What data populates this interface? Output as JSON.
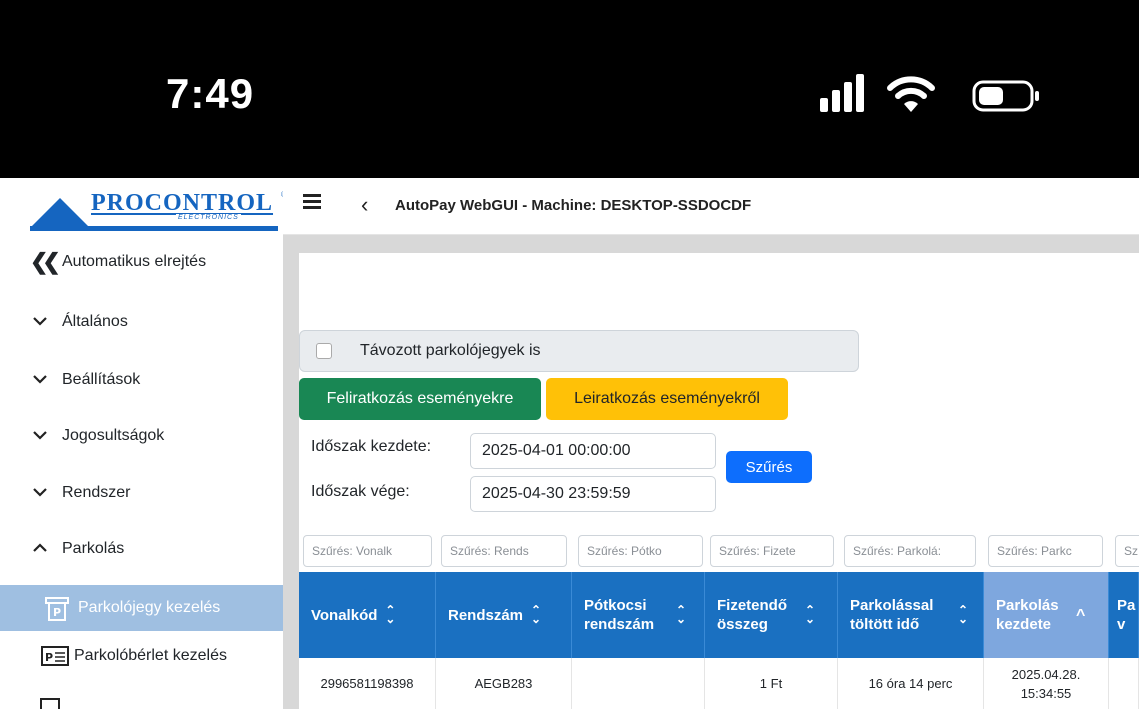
{
  "status_bar": {
    "time": "7:49"
  },
  "sidebar": {
    "logo_text": "PROCONTROL",
    "logo_sub": "ELECTRONICS",
    "collapse_label": "Automatikus elrejtés",
    "sections": [
      {
        "label": "Általános",
        "expanded": false
      },
      {
        "label": "Beállítások",
        "expanded": false
      },
      {
        "label": "Jogosultságok",
        "expanded": false
      },
      {
        "label": "Rendszer",
        "expanded": false
      },
      {
        "label": "Parkolás",
        "expanded": true
      }
    ],
    "sub_items": [
      {
        "label": "Parkolójegy kezelés",
        "active": true
      },
      {
        "label": "Parkolóbérlet kezelés",
        "active": false
      }
    ]
  },
  "topnav": {
    "title": "AutoPay WebGUI - Machine: DESKTOP-SSDOCDF"
  },
  "content": {
    "checkbox_label": "Távozott parkolójegyek is",
    "checkbox_checked": false,
    "subscribe_button": "Feliratkozás eseményekre",
    "unsubscribe_button": "Leiratkozás eseményekről",
    "start_label": "Időszak kezdete:",
    "end_label": "Időszak vége:",
    "start_value": "2025-04-01 00:00:00",
    "end_value": "2025-04-30 23:59:59",
    "filter_button": "Szűrés",
    "column_filters": [
      "Szűrés: Vonalk",
      "Szűrés: Rends",
      "Szűrés: Pótko",
      "Szűrés: Fizete",
      "Szűrés: Parkolá:",
      "Szűrés: Parkc",
      "Sz"
    ],
    "columns": [
      "Vonalkód",
      "Rendszám",
      "Pótkocsi rendszám",
      "Fizetendő összeg",
      "Parkolással töltött idő",
      "Parkolás kezdete",
      "Pa v"
    ],
    "rows": [
      [
        "2996581198398",
        "AEGB283",
        "",
        "1 Ft",
        "16 óra 14 perc",
        "2025.04.28. 15:34:55",
        ""
      ]
    ]
  },
  "colors": {
    "brand_blue": "#1565c0",
    "table_header": "#1a70c1",
    "sorted_header": "#7ea7de",
    "success": "#198754",
    "warning": "#ffc107",
    "primary": "#0d6efd",
    "sidebar_active": "#9fbfe1"
  }
}
